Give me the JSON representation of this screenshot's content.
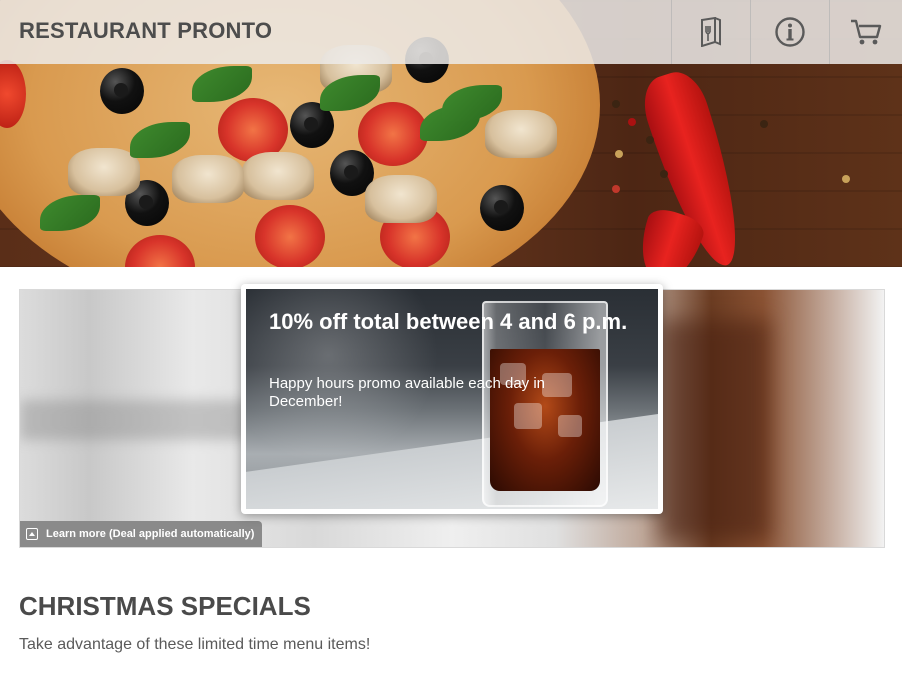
{
  "header": {
    "brand": "RESTAURANT PRONTO",
    "nav": [
      {
        "icon": "menu-book-icon"
      },
      {
        "icon": "info-icon"
      },
      {
        "icon": "cart-icon"
      }
    ]
  },
  "promo": {
    "title": "10% off total between 4 and 6 p.m.",
    "description": "Happy hours promo available each day in December!",
    "learn_more": "Learn more (Deal applied automatically)"
  },
  "section": {
    "title": "CHRISTMAS SPECIALS",
    "subtitle": "Take advantage of these limited time menu items!"
  },
  "colors": {
    "header_bg": "#eceae8",
    "text_dark": "#4a4a4a",
    "learn_more_bg": "#8a8a8a",
    "chili_red": "#e8231f"
  }
}
